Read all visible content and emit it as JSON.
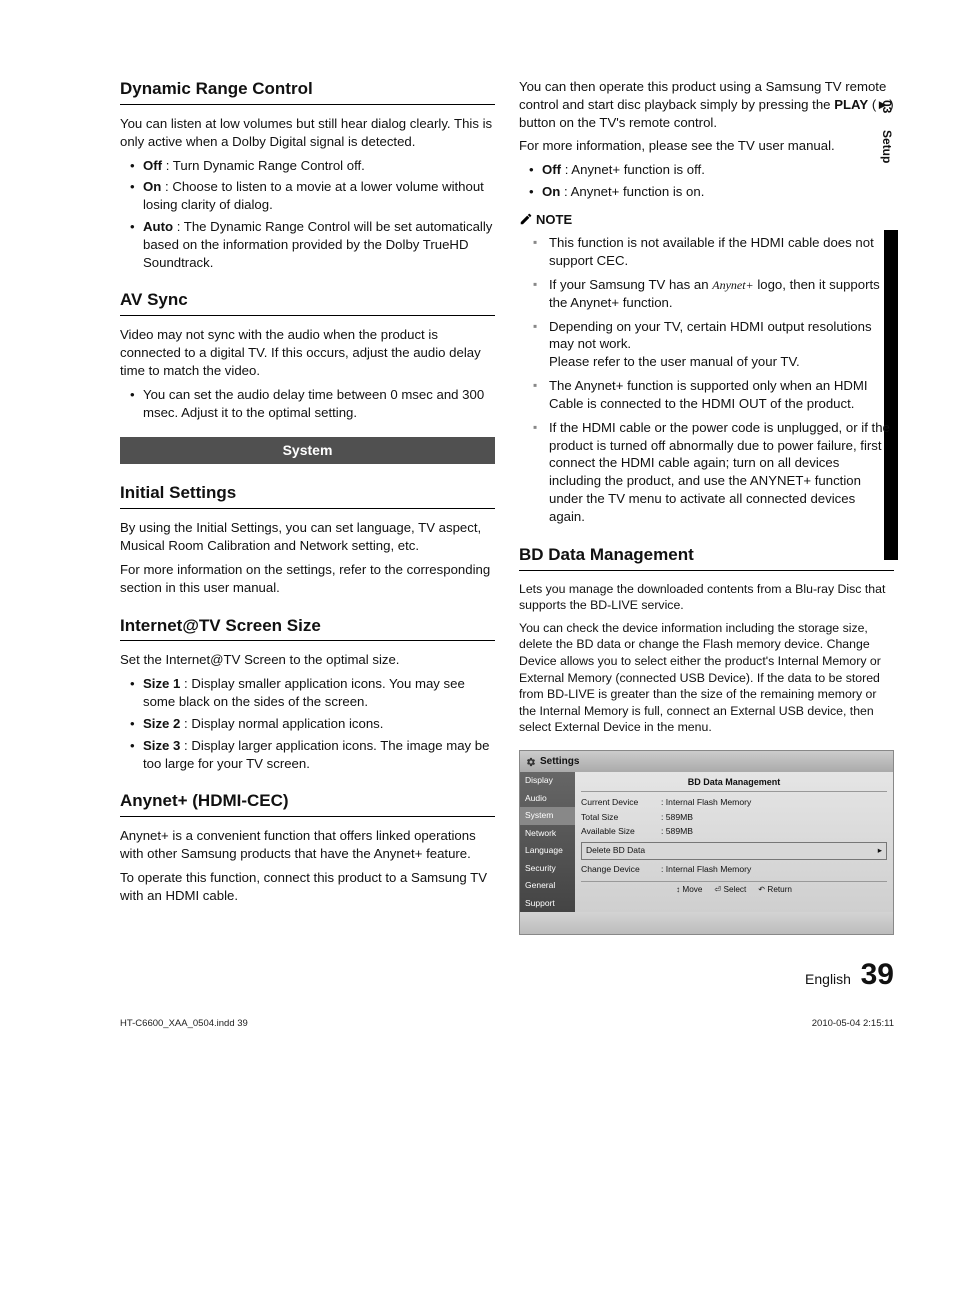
{
  "tab": {
    "num": "03",
    "name": "Setup"
  },
  "left": {
    "drc": {
      "title": "Dynamic Range Control",
      "intro": "You can listen at low volumes but still hear dialog clearly. This is only active when a Dolby Digital signal is detected.",
      "off_label": "Off",
      "off_text": " : Turn Dynamic Range Control off.",
      "on_label": "On",
      "on_text": " : Choose to listen to a movie at a lower volume without losing clarity of dialog.",
      "auto_label": "Auto",
      "auto_text": " : The Dynamic Range Control will be set automatically based on the information provided by the Dolby TrueHD Soundtrack."
    },
    "avsync": {
      "title": "AV Sync",
      "intro": "Video may not sync with the audio when the product is connected to a digital TV. If this occurs, adjust the audio delay time to match the video.",
      "bullet": "You can set the audio delay time between 0 msec and 300 msec. Adjust it to the optimal setting."
    },
    "system_bar": "System",
    "initial": {
      "title": "Initial Settings",
      "p1": "By using the Initial Settings, you can set language, TV aspect, Musical Room Calibration and Network setting, etc.",
      "p2": "For more information on the settings, refer to the corresponding section in this user manual."
    },
    "iatv": {
      "title": "Internet@TV Screen Size",
      "intro": "Set the Internet@TV Screen to the optimal size.",
      "s1l": "Size 1",
      "s1t": " : Display smaller application icons. You may see some black on the sides of the screen.",
      "s2l": "Size 2",
      "s2t": " : Display normal application icons.",
      "s3l": "Size 3",
      "s3t": " : Display larger application icons. The image may be too large for your TV screen."
    },
    "anynet": {
      "title": "Anynet+ (HDMI-CEC)",
      "p1": "Anynet+ is a convenient function that offers linked operations with other Samsung products that have the Anynet+ feature.",
      "p2": "To operate this function, connect this product to a Samsung TV with an HDMI cable."
    }
  },
  "right": {
    "intro1a": "You can then operate this product using a Samsung TV remote control and start disc playback simply by pressing the ",
    "play": "PLAY",
    "playglyph": " (►) ",
    "intro1b": "button on the TV's remote control.",
    "intro2": "For more information, please see the TV user manual.",
    "off_label": "Off",
    "off_text": " : Anynet+ function is off.",
    "on_label": "On",
    "on_text": " : Anynet+ function is on.",
    "note_label": "NOTE",
    "n1": "This function is not available if the HDMI cable does not support CEC.",
    "n2a": "If your Samsung TV has an ",
    "n2logo": "Anynet+",
    "n2b": " logo, then it supports the Anynet+ function.",
    "n3a": "Depending on your TV, certain HDMI output resolutions may not work.",
    "n3b": "Please refer to the user manual of your TV.",
    "n4": "The Anynet+ function is supported only when an HDMI Cable is connected to the HDMI OUT of the product.",
    "n5": "If the HDMI cable or the power code is unplugged, or if the product is turned off abnormally due to power failure, first connect the HDMI cable again; turn on all devices including the product, and use the ANYNET+ function under the TV menu to activate all connected devices again.",
    "bd": {
      "title": "BD Data Management",
      "p1": "Lets you manage the downloaded contents from a Blu-ray Disc that supports the BD-LIVE service.",
      "p2": "You can check the device information including the storage size, delete the BD data or change the Flash memory device. Change Device allows you to select either the product's Internal Memory or External Memory (connected USB Device). If the data to be stored from BD-LIVE is greater than the size of the remaining memory or the Internal Memory is full, connect an External USB device, then select External Device in the menu."
    }
  },
  "panel": {
    "header": "Settings",
    "menu": [
      "Display",
      "Audio",
      "System",
      "Network",
      "Language",
      "Security",
      "General",
      "Support"
    ],
    "active_index": 2,
    "title": "BD Data Management",
    "rows": [
      {
        "k": "Current Device",
        "v": ": Internal Flash Memory"
      },
      {
        "k": "Total Size",
        "v": ": 589MB"
      },
      {
        "k": "Available Size",
        "v": ": 589MB"
      }
    ],
    "delete_label": "Delete BD Data",
    "delete_arrow": "▸",
    "change_k": "Change Device",
    "change_v": ": Internal Flash Memory",
    "nav": {
      "move": "↕ Move",
      "select": "⏎ Select",
      "return": "↶ Return"
    }
  },
  "footer": {
    "lang": "English",
    "page": "39"
  },
  "meta": {
    "file": "HT-C6600_XAA_0504.indd   39",
    "date": "2010-05-04   2:15:11"
  }
}
